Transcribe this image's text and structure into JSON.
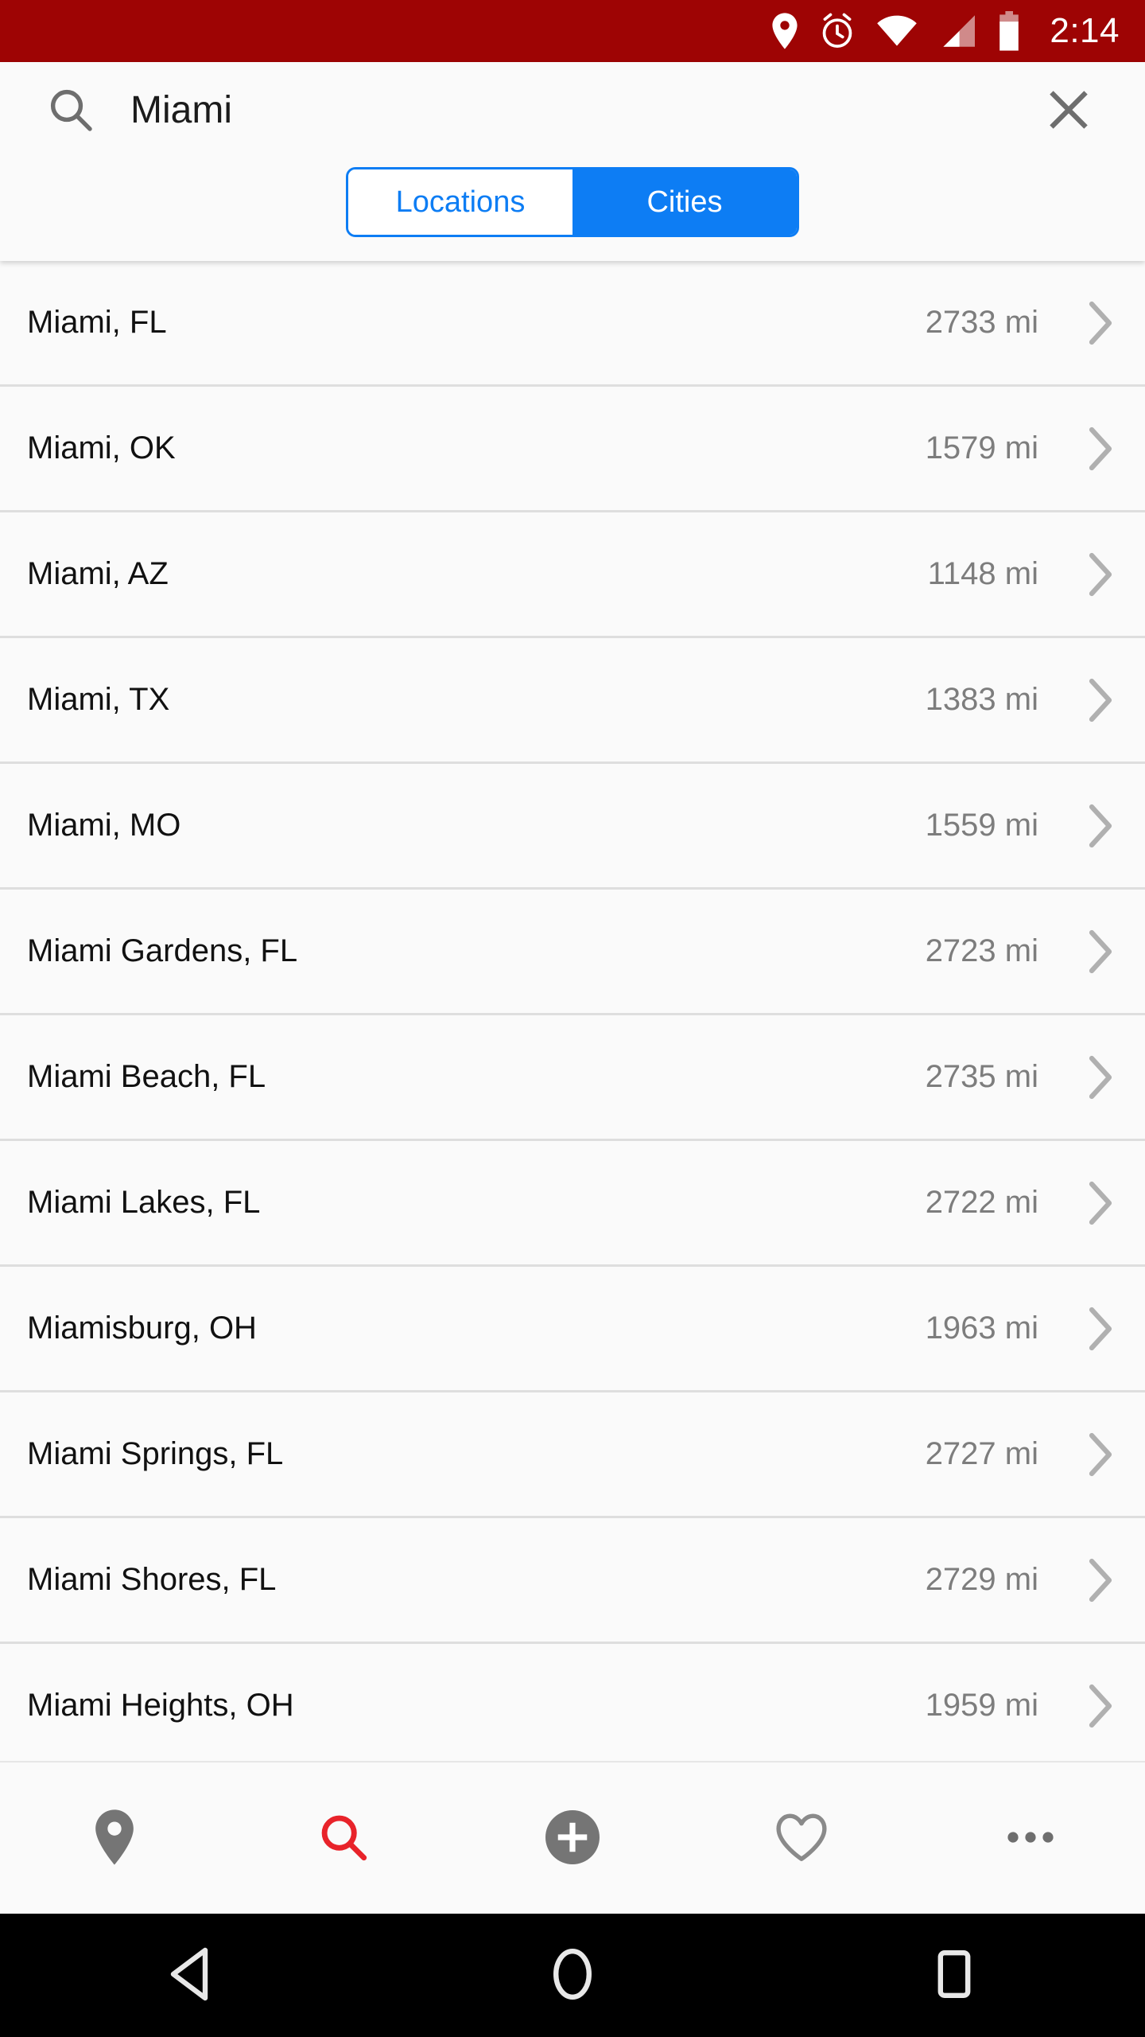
{
  "status_bar": {
    "background": "#9e0404",
    "time": "2:14",
    "icons": [
      "location-pin-icon",
      "alarm-clock-icon",
      "wifi-icon",
      "cellular-signal-icon",
      "battery-icon"
    ]
  },
  "search": {
    "icon": "search-icon",
    "value": "Miami",
    "placeholder": "Search",
    "clear_icon": "close-icon"
  },
  "segmented_control": {
    "accent_color": "#0d7df4",
    "options": [
      {
        "label": "Locations",
        "selected": false
      },
      {
        "label": "Cities",
        "selected": true
      }
    ]
  },
  "results": {
    "distance_unit": "mi",
    "rows": [
      {
        "name": "Miami, FL",
        "distance": "2733 mi"
      },
      {
        "name": "Miami, OK",
        "distance": "1579 mi"
      },
      {
        "name": "Miami, AZ",
        "distance": "1148 mi"
      },
      {
        "name": "Miami, TX",
        "distance": "1383 mi"
      },
      {
        "name": "Miami, MO",
        "distance": "1559 mi"
      },
      {
        "name": "Miami Gardens, FL",
        "distance": "2723 mi"
      },
      {
        "name": "Miami Beach, FL",
        "distance": "2735 mi"
      },
      {
        "name": "Miami Lakes, FL",
        "distance": "2722 mi"
      },
      {
        "name": "Miamisburg, OH",
        "distance": "1963 mi"
      },
      {
        "name": "Miami Springs, FL",
        "distance": "2727 mi"
      },
      {
        "name": "Miami Shores, FL",
        "distance": "2729 mi"
      },
      {
        "name": "Miami Heights, OH",
        "distance": "1959 mi"
      }
    ]
  },
  "bottom_toolbar": {
    "active_color": "#e8232a",
    "inactive_color": "#757575",
    "items": [
      {
        "icon": "location-pin-icon",
        "label": "Location",
        "active": false
      },
      {
        "icon": "search-icon",
        "label": "Search",
        "active": true
      },
      {
        "icon": "add-circle-icon",
        "label": "Add",
        "active": false
      },
      {
        "icon": "heart-icon",
        "label": "Favorites",
        "active": false
      },
      {
        "icon": "overflow-menu-icon",
        "label": "More",
        "active": false
      }
    ]
  },
  "nav_bar": {
    "background": "#000000",
    "items": [
      {
        "icon": "back-triangle-icon",
        "label": "Back"
      },
      {
        "icon": "home-circle-icon",
        "label": "Home"
      },
      {
        "icon": "recents-square-icon",
        "label": "Recents"
      }
    ]
  }
}
